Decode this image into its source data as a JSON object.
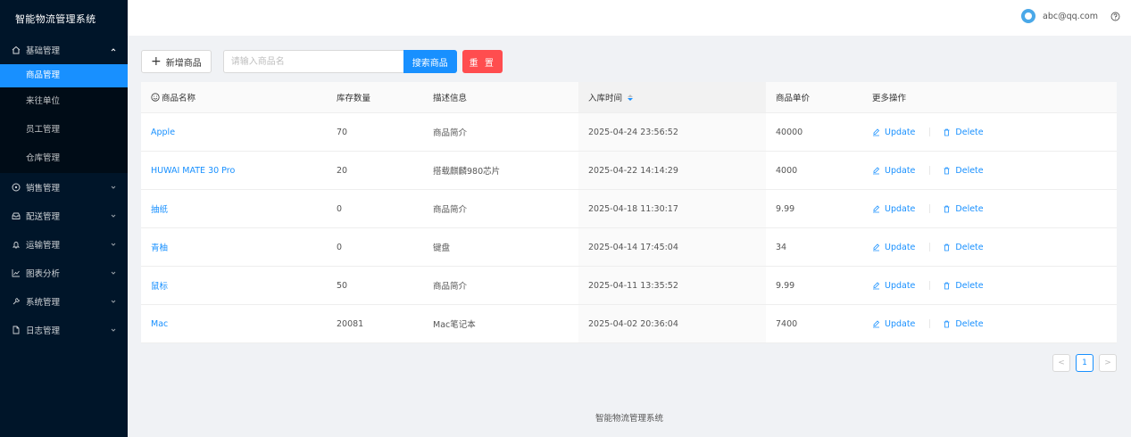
{
  "app": {
    "title": "智能物流管理系统"
  },
  "sidebar": {
    "groups": [
      {
        "label": "基础管理",
        "icon": "home-icon",
        "expanded": true,
        "items": [
          {
            "label": "商品管理",
            "active": true
          },
          {
            "label": "来往单位"
          },
          {
            "label": "员工管理"
          },
          {
            "label": "仓库管理"
          }
        ]
      },
      {
        "label": "销售管理",
        "icon": "dollar-circle-icon"
      },
      {
        "label": "配送管理",
        "icon": "inbox-icon"
      },
      {
        "label": "运输管理",
        "icon": "bell-icon"
      },
      {
        "label": "图表分析",
        "icon": "line-chart-icon"
      },
      {
        "label": "系统管理",
        "icon": "tool-icon"
      },
      {
        "label": "日志管理",
        "icon": "file-icon"
      }
    ]
  },
  "header": {
    "user_email": "abc@qq.com",
    "avatar_icon": "avatar-icon",
    "help_icon": "question-circle-icon"
  },
  "toolbar": {
    "add_label": "新增商品",
    "search_placeholder": "请输入商品名",
    "search_value": "",
    "search_label": "搜索商品",
    "reset_label": "重 置"
  },
  "table": {
    "columns": [
      "商品名称",
      "库存数量",
      "描述信息",
      "入库时间",
      "商品单价",
      "更多操作"
    ],
    "rows": [
      {
        "name": "Apple",
        "stock": "70",
        "desc": "商品简介",
        "time": "2025-04-24 23:56:52",
        "price": "40000"
      },
      {
        "name": "HUWAI MATE 30 Pro",
        "stock": "20",
        "desc": "搭载麒麟980芯片",
        "time": "2025-04-22 14:14:29",
        "price": "4000"
      },
      {
        "name": "抽纸",
        "stock": "0",
        "desc": "商品简介",
        "time": "2025-04-18 11:30:17",
        "price": "9.99"
      },
      {
        "name": "青柚",
        "stock": "0",
        "desc": "键盘",
        "time": "2025-04-14 17:45:04",
        "price": "34"
      },
      {
        "name": "鼠标",
        "stock": "50",
        "desc": "商品简介",
        "time": "2025-04-11 13:35:52",
        "price": "9.99"
      },
      {
        "name": "Mac",
        "stock": "20081",
        "desc": "Mac笔记本",
        "time": "2025-04-02 20:36:04",
        "price": "7400"
      }
    ],
    "update_label": "Update",
    "delete_label": "Delete"
  },
  "pagination": {
    "prev": "<",
    "current": "1",
    "next": ">"
  },
  "footer": {
    "text": "智能物流管理系统"
  },
  "colors": {
    "primary": "#1890ff",
    "danger": "#ff4d4f",
    "sidebar_bg": "#001529"
  }
}
